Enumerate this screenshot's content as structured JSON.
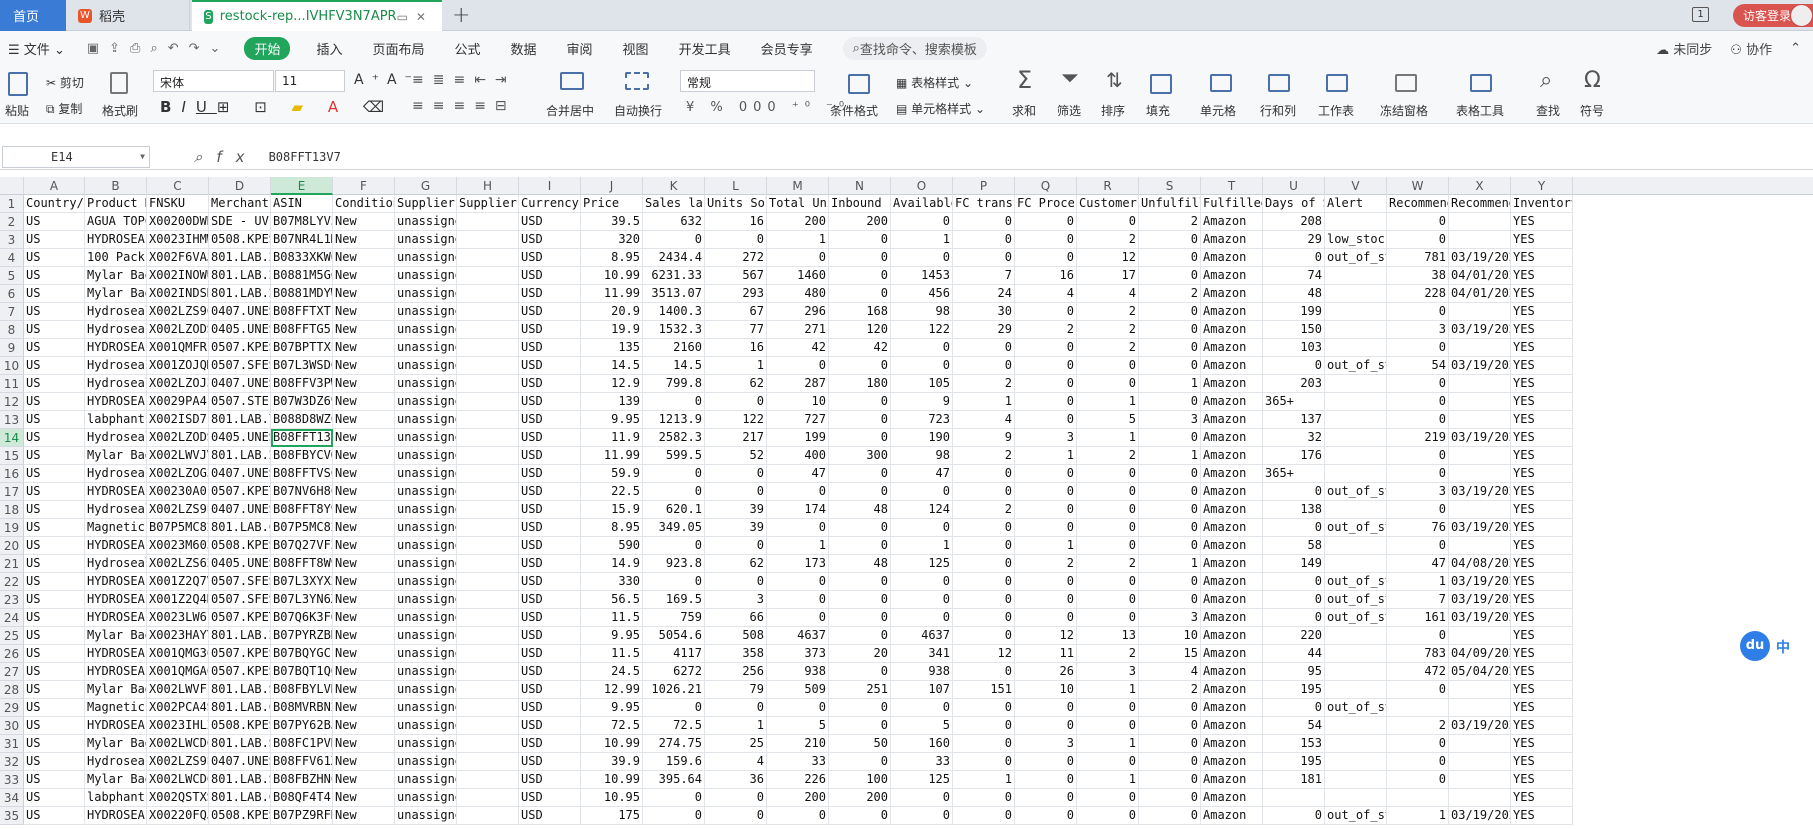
{
  "tabs": [
    {
      "label": "首页"
    },
    {
      "label": "稻壳"
    },
    {
      "label": "restock-rep...IVHFV3N7APR"
    }
  ],
  "header_right": {
    "badge": "1",
    "login_label": "访客登录"
  },
  "menu": {
    "file": "文件",
    "start": "开始",
    "items": [
      "插入",
      "页面布局",
      "公式",
      "数据",
      "审阅",
      "视图",
      "开发工具",
      "会员专享"
    ],
    "search_placeholder": "查找命令、搜索模板",
    "unsynced": "未同步",
    "collab": "协作"
  },
  "ribbon": {
    "paste": "粘贴",
    "cut": "剪切",
    "copy": "复制",
    "format_painter": "格式刷",
    "font_name": "宋体",
    "font_size": "11",
    "merge_center": "合并居中",
    "wrap": "自动换行",
    "number_format": "常规",
    "table_style": "表格样式",
    "cond_format": "条件格式",
    "cell_style": "单元格样式",
    "sum": "求和",
    "filter": "筛选",
    "sort": "排序",
    "fill": "填充",
    "cell": "单元格",
    "rowcol": "行和列",
    "sheet": "工作表",
    "freeze": "冻结窗格",
    "table_tools": "表格工具",
    "find": "查找",
    "symbol": "符号"
  },
  "formula_bar": {
    "name_box": "E14",
    "value": "B08FFT13V7"
  },
  "columns": [
    "A",
    "B",
    "C",
    "D",
    "E",
    "F",
    "G",
    "H",
    "I",
    "J",
    "K",
    "L",
    "M",
    "N",
    "O",
    "P",
    "Q",
    "R",
    "S",
    "T",
    "U",
    "V",
    "W",
    "X",
    "Y"
  ],
  "selected_cell": {
    "row": 14,
    "col": "E"
  },
  "rows": [
    [
      "Country/R",
      "Product N",
      "FNSKU",
      "Merchant",
      "ASIN",
      "Condition",
      "Supplier",
      "Supplier",
      "Currency",
      "Price",
      "Sales las",
      "Units Sol",
      "Total Uni",
      "Inbound",
      "Available",
      "FC transf",
      "FC Proces",
      "Customer",
      "Unfulfill",
      "Fulfilled",
      "Days of S",
      "Alert",
      "Recommend",
      "Recommend",
      "Inventory"
    ],
    [
      "US",
      "AGUA TOPC",
      "X00200DWR2",
      "SDE - UV1",
      "B07M8LYV5",
      "New",
      "unassigned",
      "",
      "USD",
      "39.5",
      "632",
      "16",
      "200",
      "200",
      "0",
      "0",
      "0",
      "0",
      "2",
      "Amazon",
      "208",
      "",
      "0",
      "",
      "YES"
    ],
    [
      "US",
      "HYDROSEAL",
      "X0023IHMW",
      "0508.KPES",
      "B07NR4L1M",
      "New",
      "unassigned",
      "",
      "USD",
      "320",
      "0",
      "0",
      "1",
      "0",
      "1",
      "0",
      "0",
      "2",
      "0",
      "Amazon",
      "29",
      "low_stock",
      "0",
      "",
      "YES"
    ],
    [
      "US",
      "100 Pack",
      "X002F6VAJ",
      "801.LAB.2",
      "B0833XKW6",
      "New",
      "unassigned",
      "",
      "USD",
      "8.95",
      "2434.4",
      "272",
      "0",
      "0",
      "0",
      "0",
      "0",
      "12",
      "0",
      "Amazon",
      "0",
      "out_of_st",
      "781",
      "03/19/202",
      "YES"
    ],
    [
      "US",
      "Mylar Bag",
      "X002INOWU",
      "801.LAB.2",
      "B0881M5GC",
      "New",
      "unassigned",
      "",
      "USD",
      "10.99",
      "6231.33",
      "567",
      "1460",
      "0",
      "1453",
      "7",
      "16",
      "17",
      "0",
      "Amazon",
      "74",
      "",
      "38",
      "04/01/202",
      "YES"
    ],
    [
      "US",
      "Mylar Bag",
      "X002INDSH",
      "801.LAB.2",
      "B0881MDYW",
      "New",
      "unassigned",
      "",
      "USD",
      "11.99",
      "3513.07",
      "293",
      "480",
      "0",
      "456",
      "24",
      "4",
      "4",
      "2",
      "Amazon",
      "48",
      "",
      "228",
      "04/01/202",
      "YES"
    ],
    [
      "US",
      "Hydroseal",
      "X002LZS9C",
      "0407.UNES",
      "B08FFTXTL",
      "New",
      "unassigned",
      "",
      "USD",
      "20.9",
      "1400.3",
      "67",
      "296",
      "168",
      "98",
      "30",
      "0",
      "2",
      "0",
      "Amazon",
      "199",
      "",
      "0",
      "",
      "YES"
    ],
    [
      "US",
      "Hydroseal",
      "X002LZODS",
      "0405.UNES",
      "B08FFTG5L",
      "New",
      "unassigned",
      "",
      "USD",
      "19.9",
      "1532.3",
      "77",
      "271",
      "120",
      "122",
      "29",
      "2",
      "2",
      "0",
      "Amazon",
      "150",
      "",
      "3",
      "03/19/202",
      "YES"
    ],
    [
      "US",
      "HYDROSEAL",
      "X001QMFRF",
      "0507.KPES",
      "B07BPTTXE",
      "New",
      "unassigned",
      "",
      "USD",
      "135",
      "2160",
      "16",
      "42",
      "42",
      "0",
      "0",
      "0",
      "2",
      "0",
      "Amazon",
      "103",
      "",
      "0",
      "",
      "YES"
    ],
    [
      "US",
      "HydroseaI",
      "X001ZOJQM",
      "0507.SFES",
      "B07L3WSDC",
      "New",
      "unassigned",
      "",
      "USD",
      "14.5",
      "14.5",
      "1",
      "0",
      "0",
      "0",
      "0",
      "0",
      "0",
      "0",
      "Amazon",
      "0",
      "out_of_st",
      "54",
      "03/19/202",
      "YES"
    ],
    [
      "US",
      "Hydroseal",
      "X002LZOJ3",
      "0407.UNES",
      "B08FFV3PW",
      "New",
      "unassigned",
      "",
      "USD",
      "12.9",
      "799.8",
      "62",
      "287",
      "180",
      "105",
      "2",
      "0",
      "0",
      "1",
      "Amazon",
      "203",
      "",
      "0",
      "",
      "YES"
    ],
    [
      "US",
      "HYDROSEAL",
      "X0029PA4F",
      "0507.STEF",
      "B07W3DZ69",
      "New",
      "unassigned",
      "",
      "USD",
      "139",
      "0",
      "0",
      "10",
      "0",
      "9",
      "1",
      "0",
      "1",
      "0",
      "Amazon",
      "365+",
      "",
      "0",
      "",
      "YES"
    ],
    [
      "US",
      "labphant",
      "X002ISD7F",
      "801.LAB.7",
      "B088D8WZC",
      "New",
      "unassigned",
      "",
      "USD",
      "9.95",
      "1213.9",
      "122",
      "727",
      "0",
      "723",
      "4",
      "0",
      "5",
      "3",
      "Amazon",
      "137",
      "",
      "0",
      "",
      "YES"
    ],
    [
      "US",
      "Hydroseal",
      "X002LZODS",
      "0405.UNES",
      "B08FFT13V7",
      "New",
      "unassigned",
      "",
      "USD",
      "11.9",
      "2582.3",
      "217",
      "199",
      "0",
      "190",
      "9",
      "3",
      "1",
      "0",
      "Amazon",
      "32",
      "",
      "219",
      "03/19/202",
      "YES"
    ],
    [
      "US",
      "Mylar Bag",
      "X002LWVJV",
      "801.LAB.2",
      "B08FBYCVG",
      "New",
      "unassigned",
      "",
      "USD",
      "11.99",
      "599.5",
      "52",
      "400",
      "300",
      "98",
      "2",
      "1",
      "2",
      "1",
      "Amazon",
      "176",
      "",
      "0",
      "",
      "YES"
    ],
    [
      "US",
      "Hydroseal",
      "X002LZOG5",
      "0407.UNES",
      "B08FFTVSC",
      "New",
      "unassigned",
      "",
      "USD",
      "59.9",
      "0",
      "0",
      "47",
      "0",
      "47",
      "0",
      "0",
      "0",
      "0",
      "Amazon",
      "365+",
      "",
      "0",
      "",
      "YES"
    ],
    [
      "US",
      "HYDROSEAL",
      "X00230A0L",
      "0507.KPET",
      "B07NV6H8C",
      "New",
      "unassigned",
      "",
      "USD",
      "22.5",
      "0",
      "0",
      "0",
      "0",
      "0",
      "0",
      "0",
      "0",
      "0",
      "Amazon",
      "0",
      "out_of_st",
      "3",
      "03/19/202",
      "YES"
    ],
    [
      "US",
      "Hydroseal",
      "X002LZS9E",
      "0407.UNES",
      "B08FFT8Y9",
      "New",
      "unassigned",
      "",
      "USD",
      "15.9",
      "620.1",
      "39",
      "174",
      "48",
      "124",
      "2",
      "0",
      "0",
      "0",
      "Amazon",
      "138",
      "",
      "0",
      "",
      "YES"
    ],
    [
      "US",
      "Magnetic",
      "B07P5MC82",
      "801.LAB.C",
      "B07P5MC82",
      "New",
      "unassigned",
      "",
      "USD",
      "8.95",
      "349.05",
      "39",
      "0",
      "0",
      "0",
      "0",
      "0",
      "0",
      "0",
      "Amazon",
      "0",
      "out_of_st",
      "76",
      "03/19/202",
      "YES"
    ],
    [
      "US",
      "HYDROSEAL",
      "X0023M603",
      "0508.KPES",
      "B07Q27VF2",
      "New",
      "unassigned",
      "",
      "USD",
      "590",
      "0",
      "0",
      "1",
      "0",
      "1",
      "0",
      "1",
      "0",
      "0",
      "Amazon",
      "58",
      "",
      "0",
      "",
      "YES"
    ],
    [
      "US",
      "Hydroseal",
      "X002LZS62",
      "0405.UNES",
      "B08FFT8W9",
      "New",
      "unassigned",
      "",
      "USD",
      "14.9",
      "923.8",
      "62",
      "173",
      "48",
      "125",
      "0",
      "2",
      "2",
      "1",
      "Amazon",
      "149",
      "",
      "47",
      "04/08/202",
      "YES"
    ],
    [
      "US",
      "HYDROSEAL",
      "X001Z2Q7V",
      "0507.SFES",
      "B07L3XYX2",
      "New",
      "unassigned",
      "",
      "USD",
      "330",
      "0",
      "0",
      "0",
      "0",
      "0",
      "0",
      "0",
      "0",
      "0",
      "Amazon",
      "0",
      "out_of_st",
      "1",
      "03/19/202",
      "YES"
    ],
    [
      "US",
      "HYDROSEAL",
      "X001Z2Q4N",
      "0507.SFES",
      "B07L3YN6X",
      "New",
      "unassigned",
      "",
      "USD",
      "56.5",
      "169.5",
      "3",
      "0",
      "0",
      "0",
      "0",
      "0",
      "0",
      "0",
      "Amazon",
      "0",
      "out_of_st",
      "7",
      "03/19/202",
      "YES"
    ],
    [
      "US",
      "HYDROSEAL",
      "X0023LW6F",
      "0507.KPET",
      "B07Q6K3F6",
      "New",
      "unassigned",
      "",
      "USD",
      "11.5",
      "759",
      "66",
      "0",
      "0",
      "0",
      "0",
      "0",
      "0",
      "3",
      "Amazon",
      "0",
      "out_of_st",
      "161",
      "03/19/202",
      "YES"
    ],
    [
      "US",
      "Mylar Bag",
      "X0023HAYY",
      "801.LAB.2",
      "B07PYRZBN",
      "New",
      "unassigned",
      "",
      "USD",
      "9.95",
      "5054.6",
      "508",
      "4637",
      "0",
      "4637",
      "0",
      "12",
      "13",
      "10",
      "Amazon",
      "220",
      "",
      "0",
      "",
      "YES"
    ],
    [
      "US",
      "HYDROSEAL",
      "X001QMG3C",
      "0507.KPES",
      "B07BQYGCF",
      "New",
      "unassigned",
      "",
      "USD",
      "11.5",
      "4117",
      "358",
      "373",
      "20",
      "341",
      "12",
      "11",
      "2",
      "15",
      "Amazon",
      "44",
      "",
      "783",
      "04/09/202",
      "YES"
    ],
    [
      "US",
      "HYDROSEAL",
      "X001QMGAC",
      "0507.KPES",
      "B07BQT1Q6",
      "New",
      "unassigned",
      "",
      "USD",
      "24.5",
      "6272",
      "256",
      "938",
      "0",
      "938",
      "0",
      "26",
      "3",
      "4",
      "Amazon",
      "95",
      "",
      "472",
      "05/04/202",
      "YES"
    ],
    [
      "US",
      "Mylar Bag",
      "X002LWVFI",
      "801.LAB.S",
      "B08FBYLVN",
      "New",
      "unassigned",
      "",
      "USD",
      "12.99",
      "1026.21",
      "79",
      "509",
      "251",
      "107",
      "151",
      "10",
      "1",
      "2",
      "Amazon",
      "195",
      "",
      "0",
      "",
      "YES"
    ],
    [
      "US",
      "Magnetic",
      "X002PCA4S",
      "801.LAB.C",
      "B08MVRBN2",
      "New",
      "unassigned",
      "",
      "USD",
      "9.95",
      "0",
      "0",
      "0",
      "0",
      "0",
      "0",
      "0",
      "0",
      "0",
      "Amazon",
      "0",
      "out_of_stock",
      "",
      "",
      "YES"
    ],
    [
      "US",
      "HYDROSEAL",
      "X0023IHLZ",
      "0508.KPES",
      "B07PY62BJ",
      "New",
      "unassigned",
      "",
      "USD",
      "72.5",
      "72.5",
      "1",
      "5",
      "0",
      "5",
      "0",
      "0",
      "0",
      "0",
      "Amazon",
      "54",
      "",
      "2",
      "03/19/202",
      "YES"
    ],
    [
      "US",
      "Mylar Bag",
      "X002LWCDC",
      "801.LAB.S",
      "B08FC1PVR",
      "New",
      "unassigned",
      "",
      "USD",
      "10.99",
      "274.75",
      "25",
      "210",
      "50",
      "160",
      "0",
      "3",
      "1",
      "0",
      "Amazon",
      "153",
      "",
      "0",
      "",
      "YES"
    ],
    [
      "US",
      "Hydroseal",
      "X002LZS9E",
      "0407.UNES",
      "B08FFV61X",
      "New",
      "unassigned",
      "",
      "USD",
      "39.9",
      "159.6",
      "4",
      "33",
      "0",
      "33",
      "0",
      "0",
      "0",
      "0",
      "Amazon",
      "195",
      "",
      "0",
      "",
      "YES"
    ],
    [
      "US",
      "Mylar Bag",
      "X002LWCDC",
      "801.LAB.S",
      "B08FBZHNC",
      "New",
      "unassigned",
      "",
      "USD",
      "10.99",
      "395.64",
      "36",
      "226",
      "100",
      "125",
      "1",
      "0",
      "1",
      "0",
      "Amazon",
      "181",
      "",
      "0",
      "",
      "YES"
    ],
    [
      "US",
      "labphant",
      "X002QSTXS",
      "801.LAB.C",
      "B08QF4T4L",
      "New",
      "unassigned",
      "",
      "USD",
      "10.95",
      "0",
      "0",
      "200",
      "200",
      "0",
      "0",
      "0",
      "0",
      "0",
      "Amazon",
      "",
      "",
      "",
      "",
      "YES"
    ],
    [
      "US",
      "HYDROSEAL",
      "X00220FQJ",
      "0508.KPES",
      "B07PZ9RFN",
      "New",
      "unassigned",
      "",
      "USD",
      "175",
      "0",
      "0",
      "0",
      "0",
      "0",
      "0",
      "0",
      "0",
      "0",
      "Amazon",
      "0",
      "out_of_st",
      "1",
      "03/19/202",
      "YES"
    ]
  ],
  "ime": {
    "du": "du",
    "zh": "中"
  }
}
